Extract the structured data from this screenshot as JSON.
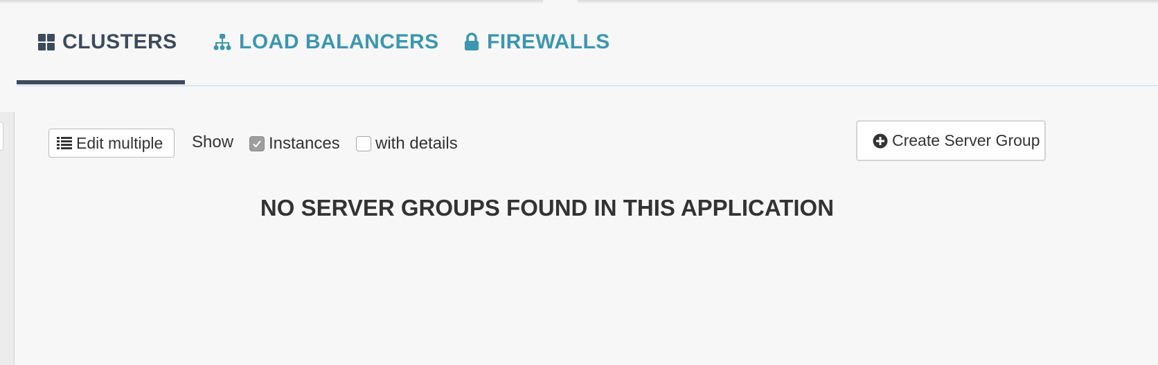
{
  "tabs": [
    {
      "label": "CLUSTERS",
      "icon": "grid-icon",
      "active": true
    },
    {
      "label": "LOAD BALANCERS",
      "icon": "sitemap-icon",
      "active": false
    },
    {
      "label": "FIREWALLS",
      "icon": "lock-icon",
      "active": false
    }
  ],
  "toolbar": {
    "edit_multiple_label": "Edit multiple",
    "show_label": "Show",
    "instances_label": "Instances",
    "instances_checked": true,
    "details_label": "with details",
    "details_checked": false,
    "create_label": "Create Server Group"
  },
  "main": {
    "empty_message": "NO SERVER GROUPS FOUND IN THIS APPLICATION"
  },
  "colors": {
    "active_tab": "#3d4a5c",
    "link_tab": "#3a97b0",
    "background": "#f7f7f7"
  }
}
